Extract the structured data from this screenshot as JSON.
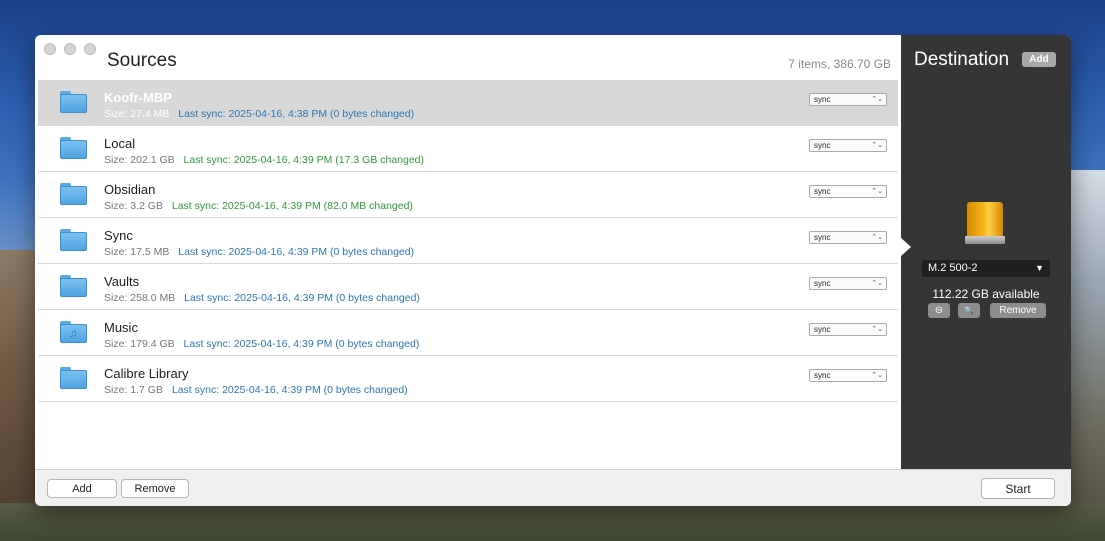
{
  "window": {
    "sources_title": "Sources",
    "summary": "7 items, 386.70 GB"
  },
  "sources": [
    {
      "name": "Koofr-MBP",
      "size": "Size: 27.4 MB",
      "last_sync": "Last sync: 2025-04-16, 4:38 PM (0 bytes changed)",
      "sync_color": "blue",
      "mode": "sync",
      "icon": "folder-icon",
      "selected": true
    },
    {
      "name": "Local",
      "size": "Size: 202.1 GB",
      "last_sync": "Last sync: 2025-04-16, 4:39 PM (17.3 GB changed)",
      "sync_color": "green",
      "mode": "sync",
      "icon": "folder-icon",
      "selected": false
    },
    {
      "name": "Obsidian",
      "size": "Size: 3.2 GB",
      "last_sync": "Last sync: 2025-04-16, 4:39 PM (82.0 MB changed)",
      "sync_color": "green",
      "mode": "sync",
      "icon": "folder-icon",
      "selected": false
    },
    {
      "name": "Sync",
      "size": "Size: 17.5 MB",
      "last_sync": "Last sync: 2025-04-16, 4:39 PM (0 bytes changed)",
      "sync_color": "blue",
      "mode": "sync",
      "icon": "folder-icon",
      "selected": false
    },
    {
      "name": "Vaults",
      "size": "Size: 258.0 MB",
      "last_sync": "Last sync: 2025-04-16, 4:39 PM (0 bytes changed)",
      "sync_color": "blue",
      "mode": "sync",
      "icon": "folder-icon",
      "selected": false
    },
    {
      "name": "Music",
      "size": "Size: 179.4 GB",
      "last_sync": "Last sync: 2025-04-16, 4:39 PM (0 bytes changed)",
      "sync_color": "blue",
      "mode": "sync",
      "icon": "music-folder-icon",
      "selected": false
    },
    {
      "name": "Calibre Library",
      "size": "Size: 1.7 GB",
      "last_sync": "Last sync: 2025-04-16, 4:39 PM (0 bytes changed)",
      "sync_color": "blue",
      "mode": "sync",
      "icon": "folder-icon",
      "selected": false
    }
  ],
  "bottom": {
    "add_label": "Add",
    "remove_label": "Remove",
    "start_label": "Start"
  },
  "destination": {
    "title": "Destination",
    "add_label": "Add",
    "drive_name": "M.2 500-2",
    "available": "112.22 GB available",
    "eject_icon": "⊖",
    "reveal_icon": "🔍",
    "remove_label": "Remove"
  },
  "colors": {
    "sync_blue": "#2a78b5",
    "sync_green": "#2e9b3a",
    "dest_panel": "#353535",
    "selected_row": "#d8d8d8"
  }
}
